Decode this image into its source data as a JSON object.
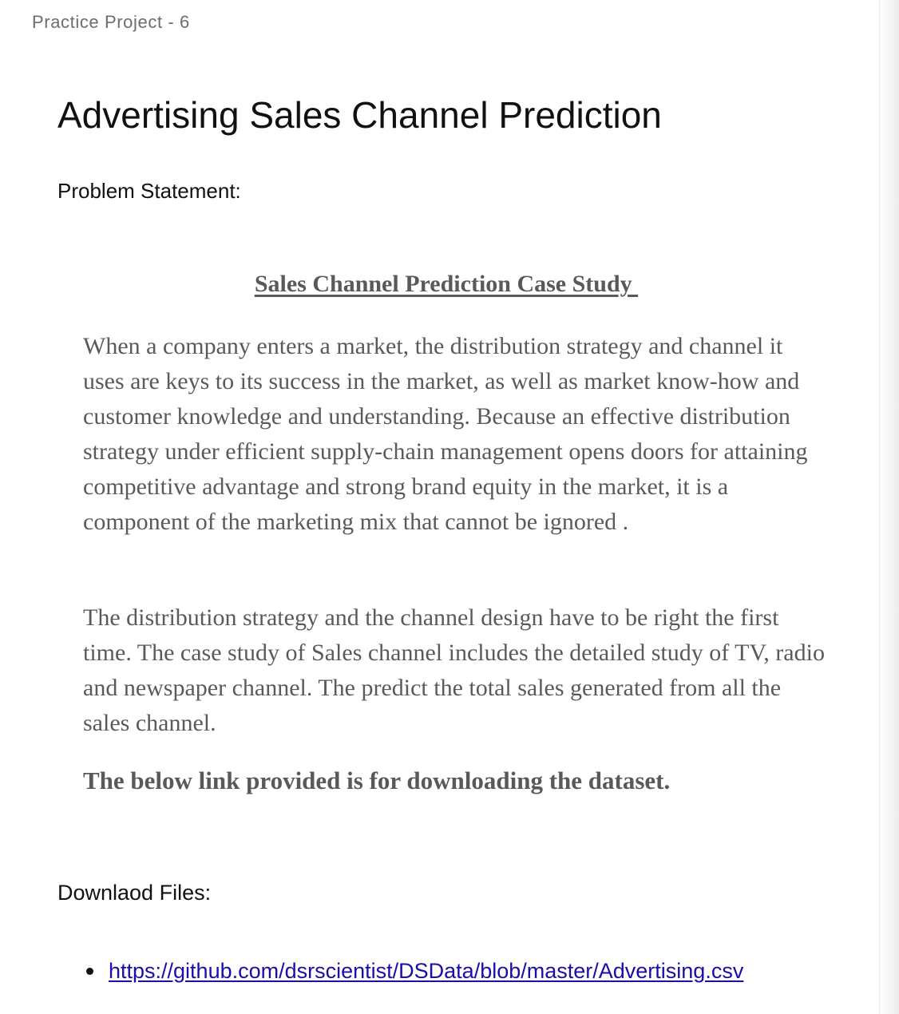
{
  "header": {
    "breadcrumb": "Practice Project - 6"
  },
  "main": {
    "title": "Advertising Sales Channel Prediction",
    "problem_label": "Problem Statement:",
    "case_study_heading": "Sales Channel Prediction Case Study ",
    "paragraphs": [
      "When a company enters a market, the distribution strategy and channel it uses are keys to its success in the market, as well as market know-how and customer knowledge and understanding. Because an effective distribution strategy under efficient supply-chain management opens doors for attaining competitive advantage and strong brand equity in the market, it is a component of the marketing mix that cannot be ignored .",
      "The distribution strategy and the channel design have to be right the first time. The case study of Sales channel includes the detailed study of TV, radio and newspaper channel. The predict the total sales generated from all the sales channel."
    ],
    "dataset_note": "The below link provided is for downloading the dataset.",
    "downloads_label": "Downlaod Files:",
    "download_links": [
      {
        "text": "https://github.com/dsrscientist/DSData/blob/master/Advertising.csv"
      }
    ]
  },
  "colors": {
    "link": "#1a0dab",
    "heading_text": "#111111",
    "body_text": "#5a5a5a",
    "breadcrumb_text": "#6d6d6d"
  }
}
